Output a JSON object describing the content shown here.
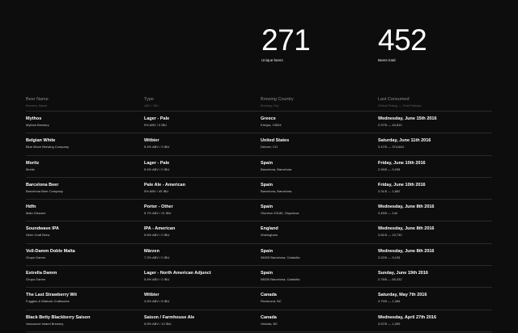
{
  "stats": {
    "unique": {
      "value": "271",
      "label": "Unique beers"
    },
    "total": {
      "value": "452",
      "label": "Beers total"
    }
  },
  "columns": [
    {
      "main": "Beer Name",
      "sub": "Brewery Name"
    },
    {
      "main": "Type",
      "sub": "ABV / IBU"
    },
    {
      "main": "Brewing Country",
      "sub": "Brewing City"
    },
    {
      "main": "Last Consumed",
      "sub": "Global Rating — Total Ratings"
    }
  ],
  "rows": [
    {
      "name": "Mythos",
      "brewery": "Mythos Brewery",
      "type": "Lager - Pale",
      "abv": "5% ABV / 0 IBU",
      "country": "Greece",
      "city": "Eπάρα, 19004",
      "date": "Wednesday, June 15th 2016",
      "rating": "2.97/5 — 40,810"
    },
    {
      "name": "Belgian White",
      "brewery": "Blue Moon Brewing Company",
      "type": "Witbier",
      "abv": "5.4% ABV / 9 IBU",
      "country": "United States",
      "city": "Denver, CO",
      "date": "Saturday, June 11th 2016",
      "rating": "3.47/5 — 374,664"
    },
    {
      "name": "Moritz",
      "brewery": "Moritz",
      "type": "Lager - Pale",
      "abv": "5.4% ABV / 0 IBU",
      "country": "Spain",
      "city": "Barcelona, Barcelona",
      "date": "Friday, June 10th 2016",
      "rating": "2.99/5 — 9,298"
    },
    {
      "name": "Barcelona Beer",
      "brewery": "Barcelona Beer Company",
      "type": "Pale Ale - American",
      "abv": "5% ABV / 45 IBU",
      "country": "Spain",
      "city": "Barcelona, Barcelona",
      "date": "Friday, June 10th 2016",
      "rating": "3.31/5 — 1,852"
    },
    {
      "name": "Hdfn",
      "brewery": "Malo Gissone",
      "type": "Porter - Other",
      "abv": "5.7% ABV / 21 IBU",
      "country": "Spain",
      "city": "Olorztun 20180, Oiquzlcoa",
      "date": "Wednesday, June 8th 2016",
      "rating": "3.49/5 — 144"
    },
    {
      "name": "Soundwave IPA",
      "brewery": "Siren Craft Brew",
      "type": "IPA - American",
      "abv": "5.6% ABV / 0 IBU",
      "country": "England",
      "city": "Wokingham",
      "date": "Wednesday, June 8th 2016",
      "rating": "3.81/5 — 10,730"
    },
    {
      "name": "Voll-Damm Doble Malta",
      "brewery": "Grupo Damm",
      "type": "Märzen",
      "abv": "7.2% ABV / 0 IBU",
      "country": "Spain",
      "city": "08005 Barcelona, Cataluña",
      "date": "Wednesday, June 8th 2016",
      "rating": "3.22/5 — 9,105"
    },
    {
      "name": "Estrella Damm",
      "brewery": "Grupo Damm",
      "type": "Lager - North American Adjunct",
      "abv": "5.4% ABV / 0 IBU",
      "country": "Spain",
      "city": "08005 Barcelona, Cataluña",
      "date": "Sunday, June 19th 2016",
      "rating": "2.78/5 — 65,332"
    },
    {
      "name": "The Last Strawberry Wit",
      "brewery": "Fuggles & Warlock Craftworks",
      "type": "Witbier",
      "abv": "4.5% ABV / 8 IBU",
      "country": "Canada",
      "city": "Richmond, BC",
      "date": "Saturday, May 7th 2016",
      "rating": "3.79/5 — 1,366"
    },
    {
      "name": "Black Betty Blackberry Saison",
      "brewery": "Vancouver Island Brewery",
      "type": "Saison / Farmhouse Ale",
      "abv": "5.5% ABV / 12 IBU",
      "country": "Canada",
      "city": "Victoria, BC",
      "date": "Wednesday, April 27th 2016",
      "rating": "3.57/5 — 1,399"
    }
  ]
}
